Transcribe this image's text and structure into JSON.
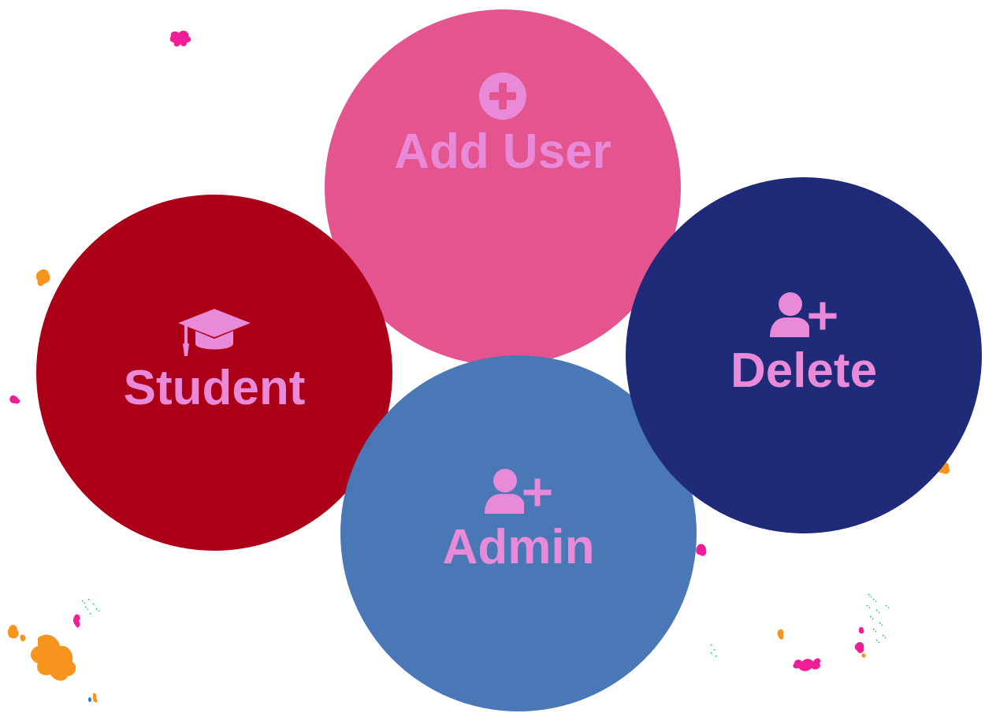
{
  "menu": {
    "add_user": {
      "label": "Add User",
      "icon": "plus-circle-icon",
      "bg": "#e4558f",
      "fg": "#e88ad8"
    },
    "student": {
      "label": "Student",
      "icon": "graduation-cap-icon",
      "bg": "#ac0019",
      "fg": "#e88ad8"
    },
    "admin": {
      "label": "Admin",
      "icon": "user-plus-icon",
      "bg": "#4a77b5",
      "fg": "#e88ad8"
    },
    "delete": {
      "label": "Delete",
      "icon": "user-plus-icon",
      "bg": "#1f2a78",
      "fg": "#e88ad8"
    }
  },
  "decor": {
    "splat_colors": [
      "#f01e96",
      "#f7941d",
      "#2ecc71"
    ]
  }
}
